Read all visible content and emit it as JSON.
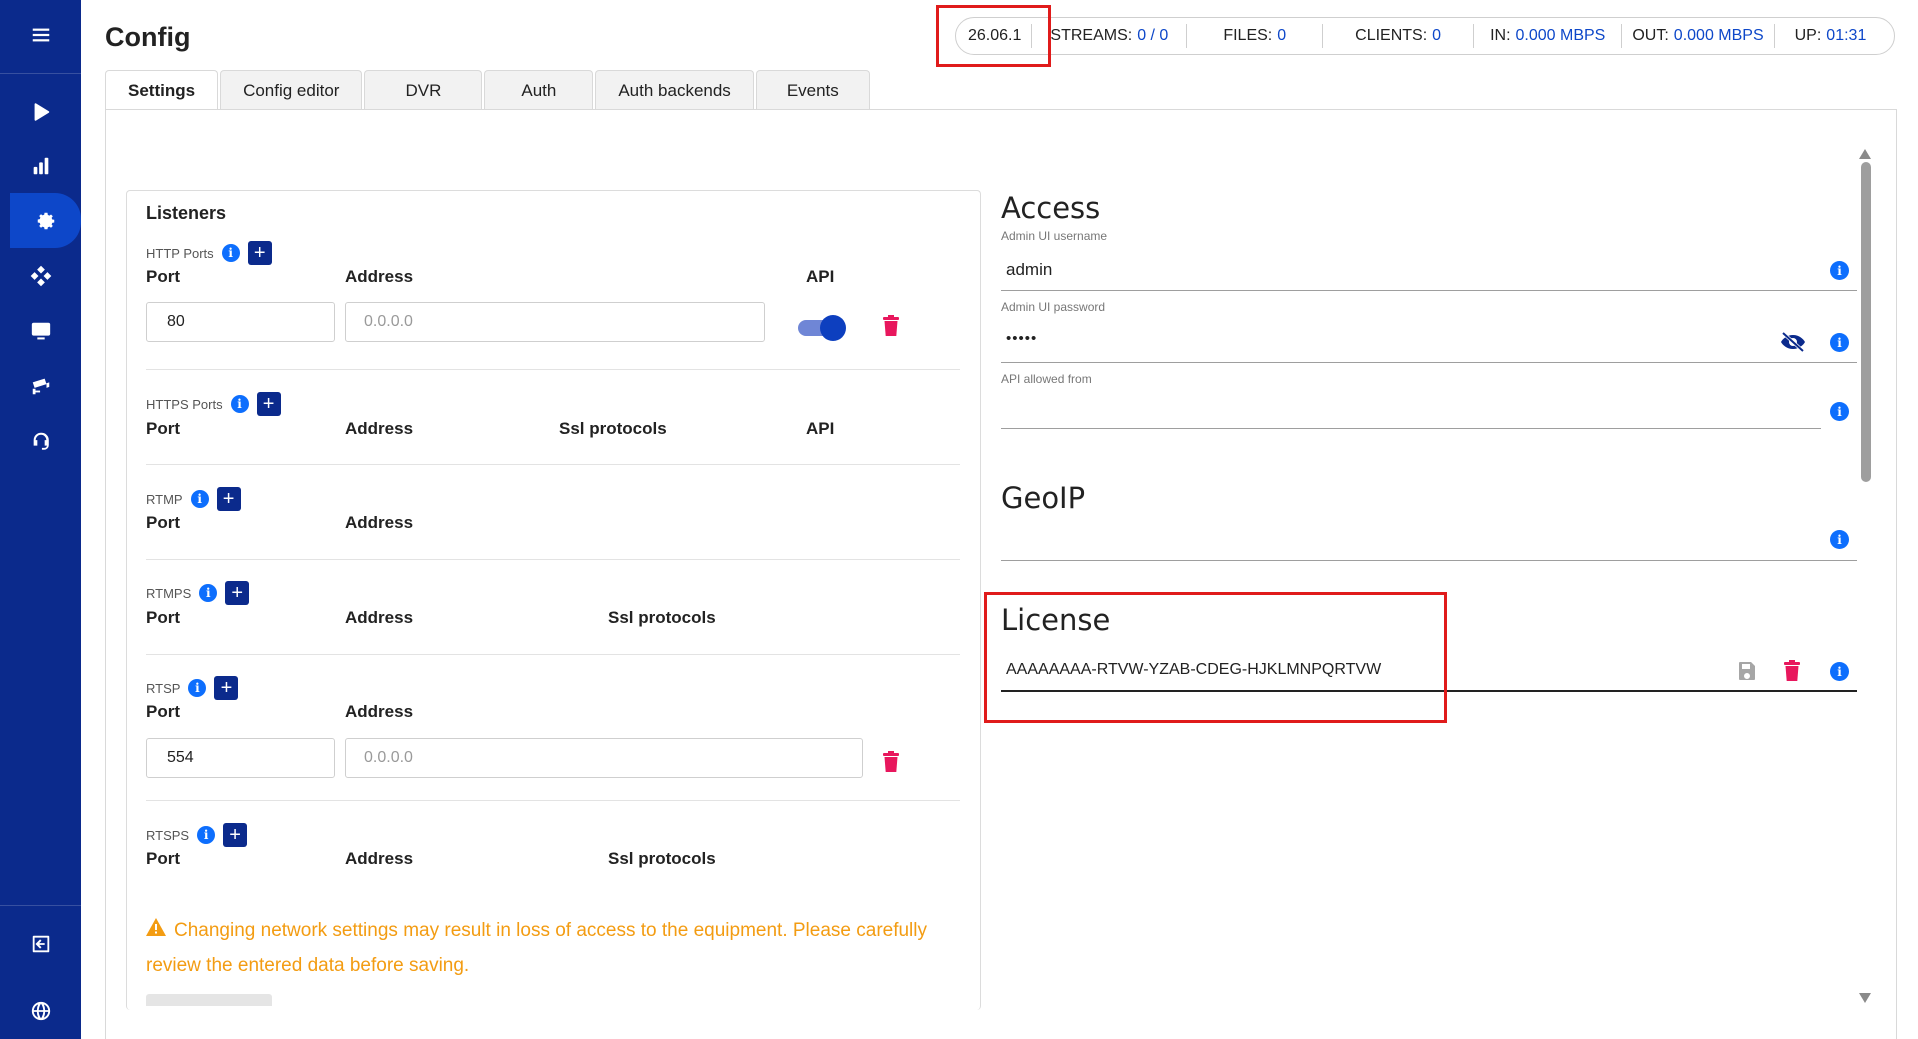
{
  "page": {
    "title": "Config"
  },
  "sidebar": {
    "items": [
      {
        "icon": "menu-icon"
      },
      {
        "icon": "play-icon"
      },
      {
        "icon": "bar-chart-icon"
      },
      {
        "icon": "gear-icon",
        "active": true
      },
      {
        "icon": "cluster-icon"
      },
      {
        "icon": "monitor-icon"
      },
      {
        "icon": "camera-icon"
      },
      {
        "icon": "headset-icon"
      },
      {
        "icon": "logout-icon"
      },
      {
        "icon": "globe-icon"
      }
    ]
  },
  "statusbar": {
    "version": "26.06.1",
    "streams_label": "STREAMS:",
    "streams_value": "0 / 0",
    "files_label": "FILES:",
    "files_value": "0",
    "clients_label": "CLIENTS:",
    "clients_value": "0",
    "in_label": "IN:",
    "in_value": "0.000 MBPS",
    "out_label": "OUT:",
    "out_value": "0.000 MBPS",
    "up_label": "UP:",
    "up_value": "01:31"
  },
  "tabs": [
    "Settings",
    "Config editor",
    "DVR",
    "Auth",
    "Auth backends",
    "Events"
  ],
  "listeners": {
    "title": "Listeners",
    "http": {
      "label": "HTTP Ports",
      "col_port": "Port",
      "col_address": "Address",
      "col_api": "API",
      "port": "80",
      "address_placeholder": "0.0.0.0",
      "api_enabled": true
    },
    "https": {
      "label": "HTTPS Ports",
      "col_port": "Port",
      "col_address": "Address",
      "col_ssl": "Ssl protocols",
      "col_api": "API"
    },
    "rtmp": {
      "label": "RTMP",
      "col_port": "Port",
      "col_address": "Address"
    },
    "rtmps": {
      "label": "RTMPS",
      "col_port": "Port",
      "col_address": "Address",
      "col_ssl": "Ssl protocols"
    },
    "rtsp": {
      "label": "RTSP",
      "col_port": "Port",
      "col_address": "Address",
      "port": "554",
      "address_placeholder": "0.0.0.0"
    },
    "rtsps": {
      "label": "RTSPS",
      "col_port": "Port",
      "col_address": "Address",
      "col_ssl": "Ssl protocols"
    },
    "warning": "Changing network settings may result in loss of access to the equipment. Please carefully review the entered data before saving."
  },
  "access": {
    "title": "Access",
    "username_label": "Admin UI username",
    "username_value": "admin",
    "password_label": "Admin UI password",
    "password_value": "•••••",
    "api_allowed_label": "API allowed from",
    "api_allowed_value": ""
  },
  "geoip": {
    "title": "GeoIP"
  },
  "license": {
    "title": "License",
    "value": "AAAAAAAA-RTVW-YZAB-CDEG-HJKLMNPQRTVW"
  },
  "colors": {
    "sidebar": "#0b2a8c",
    "accent": "#0d47c9",
    "danger": "#e8175d",
    "warning": "#f39c12",
    "highlight": "#e01b1b"
  }
}
